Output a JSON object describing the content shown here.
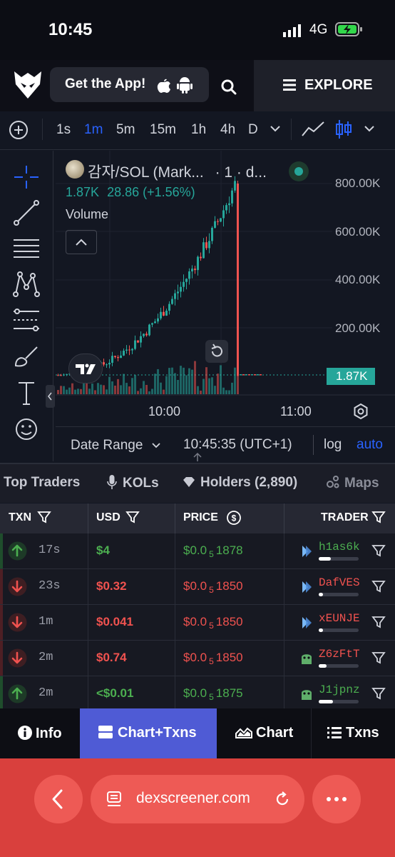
{
  "status": {
    "time": "10:45",
    "network": "4G"
  },
  "header": {
    "get_app": "Get the App!",
    "explore": "EXPLORE"
  },
  "toolbar": {
    "intervals": [
      "1s",
      "1m",
      "5m",
      "15m",
      "1h",
      "4h",
      "D"
    ],
    "active_interval": "1m"
  },
  "chart": {
    "title": "감자/SOL (Mark...",
    "title_suffix": "· 1 · d...",
    "ohlc_open": "1.87K",
    "ohlc_change": "28.86 (+1.56%)",
    "volume_label": "Volume",
    "y_ticks": [
      "800.00K",
      "600.00K",
      "400.00K",
      "200.00K"
    ],
    "last_price": "1.87K",
    "x_ticks": [
      "10:00",
      "11:00"
    ],
    "up_color": "#26a69a",
    "down_color": "#ef5350"
  },
  "chart_bottom": {
    "date_range": "Date Range",
    "clock": "10:45:35 (UTC+1)",
    "log": "log",
    "auto": "auto"
  },
  "tabs": [
    "Top Traders",
    "KOLs",
    "Holders (2,890)",
    "Maps"
  ],
  "table": {
    "headers": [
      "TXN",
      "USD",
      "PRICE",
      "TRADER"
    ],
    "rows": [
      {
        "dir": "up",
        "age": "17s",
        "usd": "$4",
        "price_a": "$0.0",
        "price_sub": "5",
        "price_b": "1878",
        "trader": "h1as6k",
        "bar": 0.3
      },
      {
        "dir": "down",
        "age": "23s",
        "usd": "$0.32",
        "price_a": "$0.0",
        "price_sub": "5",
        "price_b": "1850",
        "trader": "DafVES",
        "bar": 0.1
      },
      {
        "dir": "down",
        "age": "1m",
        "usd": "$0.041",
        "price_a": "$0.0",
        "price_sub": "5",
        "price_b": "1850",
        "trader": "xEUNJE",
        "bar": 0.1
      },
      {
        "dir": "down",
        "age": "2m",
        "usd": "$0.74",
        "price_a": "$0.0",
        "price_sub": "5",
        "price_b": "1850",
        "trader": "Z6zFtT",
        "bar": 0.2
      },
      {
        "dir": "up",
        "age": "2m",
        "usd": "<$0.01",
        "price_a": "$0.0",
        "price_sub": "5",
        "price_b": "1875",
        "trader": "J1jpnz",
        "bar": 0.35
      }
    ]
  },
  "bottom_nav": [
    "Info",
    "Chart+Txns",
    "Chart",
    "Txns"
  ],
  "browser": {
    "url": "dexscreener.com"
  }
}
